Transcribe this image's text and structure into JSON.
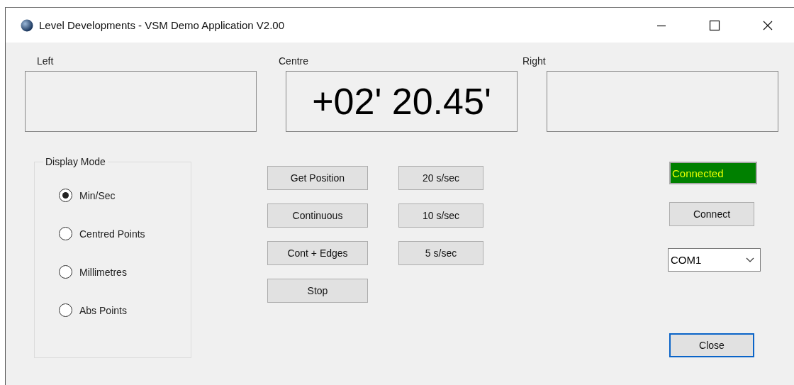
{
  "window": {
    "title": "Level Developments - VSM Demo Application V2.00"
  },
  "displays": [
    {
      "label": "Left"
    },
    {
      "label": "Centre",
      "value": "+02' 20.45'"
    },
    {
      "label": "Right"
    }
  ],
  "display_mode": {
    "title": "Display Mode",
    "options": [
      {
        "label": "Min/Sec",
        "selected": true
      },
      {
        "label": "Centred Points",
        "selected": false
      },
      {
        "label": "Millimetres",
        "selected": false
      },
      {
        "label": "Abs Points",
        "selected": false
      }
    ]
  },
  "action_buttons": [
    "Get Position",
    "Continuous",
    "Cont + Edges",
    "Stop"
  ],
  "rate_buttons": [
    "20 s/sec",
    "10 s/sec",
    "5 s/sec"
  ],
  "status": {
    "text": "Connected",
    "connected": true
  },
  "connect_button": "Connect",
  "port": {
    "value": "COM1"
  },
  "close_button": {
    "label": "Close",
    "focused": true
  }
}
